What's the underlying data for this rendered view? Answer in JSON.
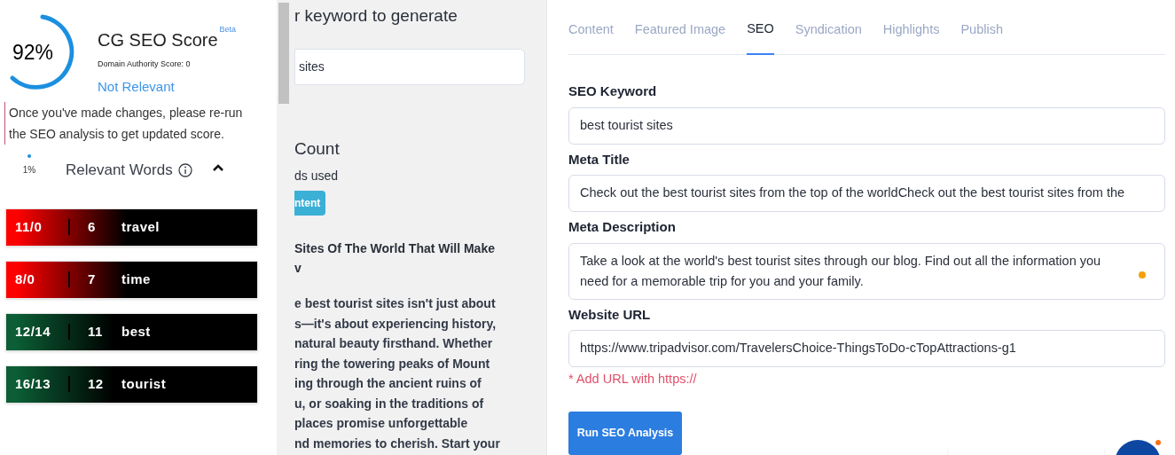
{
  "score": {
    "value": "92%",
    "title": "CG SEO Score",
    "badge": "Beta",
    "domain_authority": "Domain Authority Score: 0",
    "relevance": "Not Relevant"
  },
  "notice": "Once you've made changes, please re-run the SEO analysis to get updated score.",
  "relevant_words": {
    "percent": "1%",
    "title": "Relevant Words",
    "expanded": true,
    "items": [
      {
        "ratio": "11/0",
        "count": "6",
        "word": "travel",
        "color": "#ff0000"
      },
      {
        "ratio": "8/0",
        "count": "7",
        "word": "time",
        "color": "#ff0000"
      },
      {
        "ratio": "12/14",
        "count": "11",
        "word": "best",
        "color": "#0b5e35"
      },
      {
        "ratio": "16/13",
        "count": "12",
        "word": "tourist",
        "color": "#0b5e35"
      }
    ]
  },
  "middle": {
    "heading": "r keyword to generate",
    "keyword_value": "sites",
    "count_title": "Count",
    "count_subtitle": "ds used",
    "button": "ntent",
    "article_title": [
      "Sites Of The World That Will Make",
      "v"
    ],
    "article_lines": [
      "e best tourist sites isn't just about",
      "s—it's about experiencing history,",
      "natural beauty firsthand. Whether",
      "ring the towering peaks of Mount",
      "ing through the ancient ruins of",
      "u, or soaking in the traditions of",
      "places promise unforgettable",
      "nd memories to cherish. Start your"
    ]
  },
  "tabs": [
    {
      "label": "Content",
      "selected": false
    },
    {
      "label": "Featured Image",
      "selected": false
    },
    {
      "label": "SEO",
      "selected": true
    },
    {
      "label": "Syndication",
      "selected": false
    },
    {
      "label": "Highlights",
      "selected": false
    },
    {
      "label": "Publish",
      "selected": false
    }
  ],
  "form": {
    "seo_keyword": {
      "label": "SEO Keyword",
      "value": "best tourist sites"
    },
    "meta_title": {
      "label": "Meta Title",
      "value": "Check out the best tourist sites from the top of the worldCheck out the best tourist sites from the"
    },
    "meta_description": {
      "label": "Meta Description",
      "value": "Take a look at the world's best tourist sites through our blog. Find out all the information you need for a memorable trip for you and your family."
    },
    "website_url": {
      "label": "Website URL",
      "value": "https://www.tripadvisor.com/TravelersChoice-ThingsToDo-cTopAttractions-g1",
      "error": "* Add URL with https://"
    },
    "submit": "Run SEO Analysis"
  }
}
